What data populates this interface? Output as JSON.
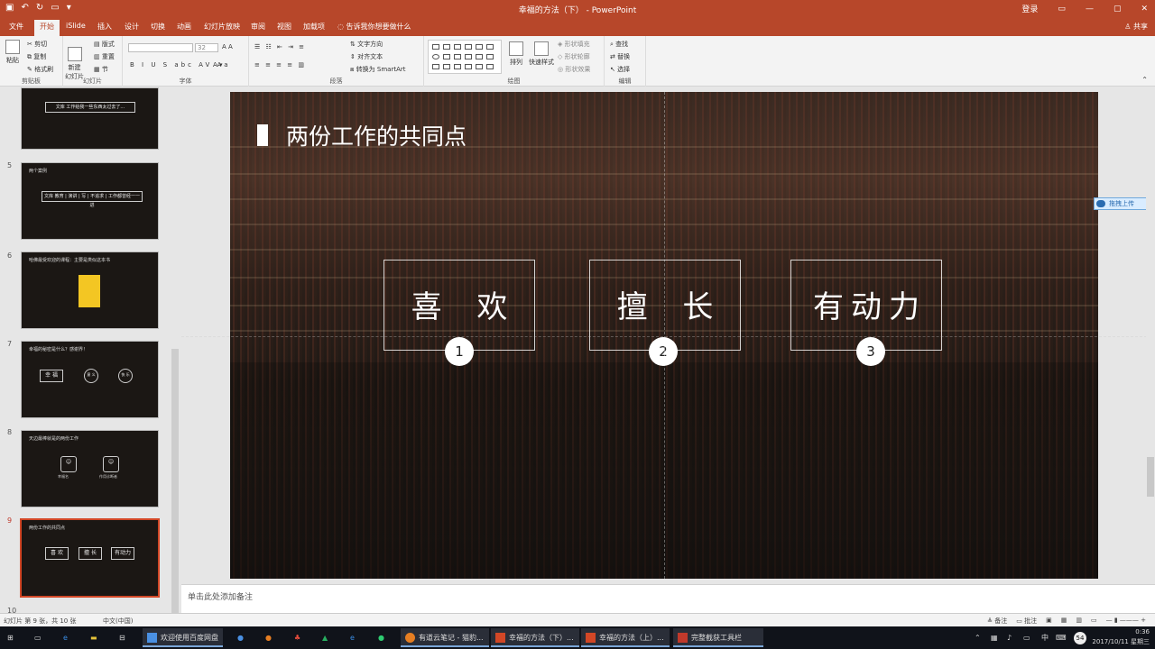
{
  "window": {
    "title": "幸福的方法（下） - PowerPoint",
    "login": "登录",
    "share": "共享"
  },
  "tabs": [
    "文件",
    "开始",
    "iSlide",
    "插入",
    "设计",
    "切换",
    "动画",
    "幻灯片放映",
    "审阅",
    "视图",
    "加载项"
  ],
  "tell_me": "告诉我你想要做什么",
  "ribbon": {
    "clipboard": {
      "label": "剪贴板",
      "paste": "粘贴",
      "cut": "剪切",
      "copy": "复制",
      "painter": "格式刷"
    },
    "slides": {
      "label": "幻灯片",
      "new_slide": "新建\n幻灯片",
      "layout": "版式",
      "reset": "重置",
      "section": "节"
    },
    "font": {
      "label": "字体",
      "size": "32"
    },
    "paragraph": {
      "label": "段落",
      "text_dir": "文字方向",
      "align_text": "对齐文本",
      "smartart": "转换为 SmartArt"
    },
    "drawing": {
      "label": "绘图",
      "arrange": "排列",
      "quick_styles": "快速样式",
      "fill": "形状填充",
      "outline": "形状轮廓",
      "effects": "形状效果"
    },
    "editing": {
      "label": "编辑",
      "find": "查找",
      "replace": "替换",
      "select": "选择"
    }
  },
  "thumbnails": [
    {
      "num": "",
      "title": "",
      "items": [
        "文库",
        "工作给我一些东西太过去了..."
      ]
    },
    {
      "num": "5",
      "title": "两个案例",
      "items": [
        "文库",
        "教育 | 演讲 | 写 | 不追求 | 工作都曾经一一进"
      ]
    },
    {
      "num": "6",
      "title": "哈佛最受欢迎的课程：主要是类似这本书",
      "items": []
    },
    {
      "num": "7",
      "title": "幸福的秘密是什么？感谢界！",
      "items": [
        "幸 福",
        "意 义",
        "快 乐"
      ]
    },
    {
      "num": "8",
      "title": "天边最棒就是的两份工作",
      "items": [
        "幸福名",
        "作用诊断者"
      ]
    },
    {
      "num": "9",
      "title": "两份工作的共同点",
      "items": [
        "喜 欢",
        "擅 长",
        "有动力"
      ]
    },
    {
      "num": "10",
      "title": "",
      "items": []
    }
  ],
  "slide": {
    "title": "两份工作的共同点",
    "boxes": [
      {
        "text": "喜 欢",
        "badge": "1"
      },
      {
        "text": "擅 长",
        "badge": "2"
      },
      {
        "text": "有动力",
        "badge": "3"
      }
    ]
  },
  "cloud_button": "拖拽上传",
  "notes_placeholder": "单击此处添加备注",
  "status": {
    "slide_info": "幻灯片 第 9 张，共 10 张",
    "language": "中文(中国)",
    "notes": "备注",
    "comments": "批注"
  },
  "taskbar": {
    "apps": [
      "欢迎使用百度网盘",
      "有道云笔记 - 猫豹...",
      "幸福的方法（下）...",
      "幸福的方法（上）...",
      "完整截获工具栏"
    ],
    "time": "0:36",
    "date": "2017/10/11 星期三",
    "ime": "中",
    "badge": "54"
  }
}
